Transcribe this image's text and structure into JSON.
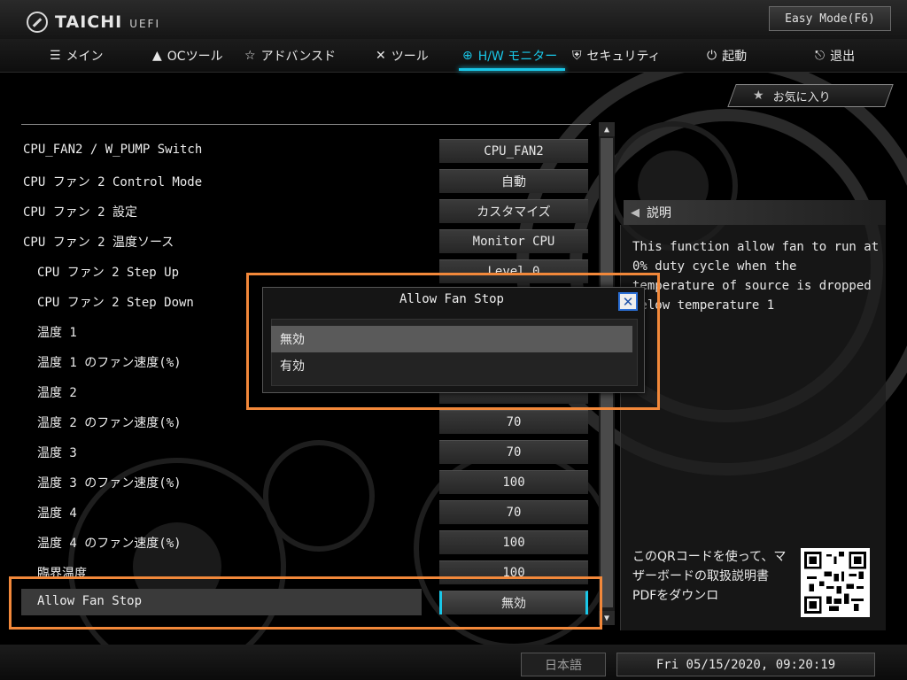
{
  "header": {
    "logo": "TAICHI",
    "logo_sub": "UEFI",
    "easy_mode": "Easy Mode(F6)"
  },
  "nav": [
    {
      "label": "メイン",
      "icon": "list-icon",
      "glyph": "☰"
    },
    {
      "label": "OCツール",
      "icon": "rocket-icon",
      "glyph": "▲"
    },
    {
      "label": "アドバンスド",
      "icon": "star-icon",
      "glyph": "☆"
    },
    {
      "label": "ツール",
      "icon": "tools-icon",
      "glyph": "✕"
    },
    {
      "label": "H/W モニター",
      "icon": "crosshair-icon",
      "glyph": "⊕",
      "active": true
    },
    {
      "label": "セキュリティ",
      "icon": "shield-icon",
      "glyph": "⛨"
    },
    {
      "label": "起動",
      "icon": "power-icon",
      "glyph": "⏻"
    },
    {
      "label": "退出",
      "icon": "exit-icon",
      "glyph": "⎋"
    }
  ],
  "favorite": {
    "label": "お気に入り",
    "icon": "star-icon"
  },
  "settings": [
    {
      "label": "CPU_FAN2 / W_PUMP Switch",
      "value": "CPU_FAN2",
      "indent": false
    },
    {
      "label": "CPU ファン 2 Control Mode",
      "value": "自動",
      "indent": false
    },
    {
      "label": "CPU ファン 2 設定",
      "value": "カスタマイズ",
      "indent": false
    },
    {
      "label": "CPU ファン 2 温度ソース",
      "value": "Monitor CPU",
      "indent": false
    },
    {
      "label": "CPU ファン 2 Step Up",
      "value": "Level 0",
      "indent": true
    },
    {
      "label": "CPU ファン 2 Step Down",
      "value": "Level 0",
      "indent": true
    },
    {
      "label": "温度 1",
      "value": "",
      "indent": true
    },
    {
      "label": "温度 1 のファン速度(%)",
      "value": "",
      "indent": true
    },
    {
      "label": "温度 2",
      "value": "",
      "indent": true
    },
    {
      "label": "温度 2 のファン速度(%)",
      "value": "70",
      "indent": true
    },
    {
      "label": "温度 3",
      "value": "70",
      "indent": true
    },
    {
      "label": "温度 3 のファン速度(%)",
      "value": "100",
      "indent": true
    },
    {
      "label": "温度 4",
      "value": "70",
      "indent": true
    },
    {
      "label": "温度 4 のファン速度(%)",
      "value": "100",
      "indent": true
    },
    {
      "label": "臨界温度",
      "value": "100",
      "indent": true
    },
    {
      "label": "Allow Fan Stop",
      "value": "無効",
      "indent": true,
      "selected": true
    }
  ],
  "description": {
    "title": "説明",
    "text": "This function allow fan to run at 0% duty cycle when the temperature of source is dropped below temperature 1",
    "qr_text": "このQRコードを使って、マザーボードの取扱説明書PDFをダウンロ"
  },
  "dialog": {
    "title": "Allow Fan Stop",
    "options": [
      "無効",
      "有効"
    ],
    "selected_index": 0
  },
  "footer": {
    "language": "日本語",
    "datetime": "Fri 05/15/2020, 09:20:19"
  },
  "colors": {
    "accent": "#19c7e8",
    "highlight": "#f2883a"
  }
}
